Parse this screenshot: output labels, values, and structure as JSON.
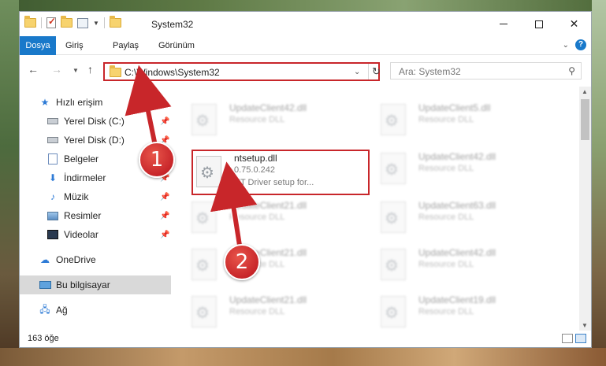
{
  "window": {
    "title": "System32",
    "controls": {
      "minimize": "—",
      "maximize": "□",
      "close": "✕"
    }
  },
  "ribbon": {
    "tabs": [
      "Dosya",
      "Giriş",
      "Paylaş",
      "Görünüm"
    ],
    "help": "?"
  },
  "navbar": {
    "address": "C:\\Windows\\System32",
    "search_placeholder": "Ara: System32"
  },
  "sidebar": {
    "items": [
      {
        "label": "Hızlı erişim",
        "icon": "star-icon"
      },
      {
        "label": "Yerel Disk (C:)",
        "icon": "drive-icon",
        "pinned": true
      },
      {
        "label": "Yerel Disk (D:)",
        "icon": "drive-icon",
        "pinned": true
      },
      {
        "label": "Belgeler",
        "icon": "documents-icon",
        "pinned": true
      },
      {
        "label": "İndirmeler",
        "icon": "download-icon",
        "pinned": true
      },
      {
        "label": "Müzik",
        "icon": "music-icon",
        "pinned": true
      },
      {
        "label": "Resimler",
        "icon": "pictures-icon",
        "pinned": true
      },
      {
        "label": "Videolar",
        "icon": "videos-icon",
        "pinned": true
      },
      {
        "label": "OneDrive",
        "icon": "onedrive-icon"
      },
      {
        "label": "Bu bilgisayar",
        "icon": "this-pc-icon",
        "selected": true
      },
      {
        "label": "Ağ",
        "icon": "network-icon"
      }
    ]
  },
  "files": {
    "left": [
      {
        "name": "UpdateClient42.dll",
        "desc": "Resource DLL"
      },
      {
        "name": "ntsetup.dll",
        "version": "0.75.0.242",
        "desc": "NT Driver setup for..."
      },
      {
        "name": "UpdateClient21.dll",
        "desc": "Resource DLL"
      },
      {
        "name": "UpdateClient21.dll",
        "desc": "Resource DLL"
      },
      {
        "name": "UpdateClient21.dll",
        "desc": "Resource DLL"
      }
    ],
    "right": [
      {
        "name": "UpdateClient5.dll",
        "desc": "Resource DLL"
      },
      {
        "name": "UpdateClient42.dll",
        "desc": "Resource DLL"
      },
      {
        "name": "UpdateClient63.dll",
        "desc": "Resource DLL"
      },
      {
        "name": "UpdateClient42.dll",
        "desc": "Resource DLL"
      },
      {
        "name": "UpdateClient19.dll",
        "desc": "Resource DLL"
      }
    ]
  },
  "status": {
    "item_count": "163 öğe"
  },
  "annotations": {
    "step1": "1",
    "step2": "2",
    "accent": "#c8262a"
  }
}
